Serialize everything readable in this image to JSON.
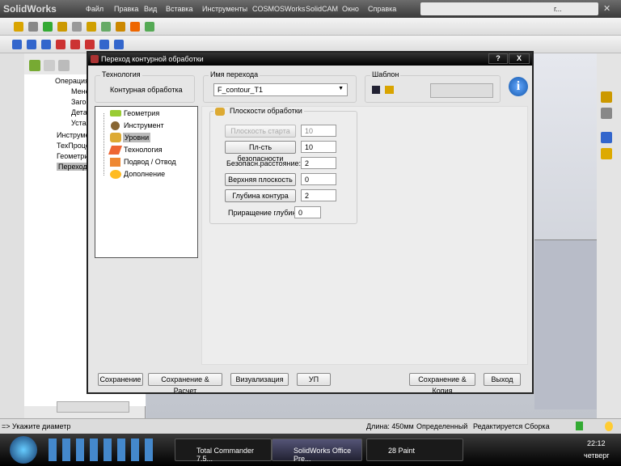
{
  "app": {
    "logo": "SolidWorks",
    "menu": [
      "Файл",
      "Правка",
      "Вид",
      "Вставка",
      "Инструменты",
      "COSMOSWorks",
      "SolidCAM",
      "Окно",
      "Справка"
    ],
    "search_short": "г..."
  },
  "tree": {
    "items": [
      "Операция",
      "Мене",
      "Заго",
      "Дета",
      "Уста",
      "Инструме",
      "ТехПроце",
      "Геометри",
      "Переход"
    ]
  },
  "dialog": {
    "title": "Переход контурной обработки",
    "help": "?",
    "close": "X",
    "tech_label": "Технология",
    "tech_value": "Контурная обработка",
    "name_label": "Имя перехода",
    "name_value": "F_contour_T1",
    "template_label": "Шаблон",
    "nav": [
      "Геометрия",
      "Инструмент",
      "Уровни",
      "Технология",
      "Подвод / Отвод",
      "Дополнение"
    ],
    "group_title": "Плоскости обработки",
    "fields": [
      {
        "label": "Плоскость старта",
        "value": "10",
        "type": "button-disabled"
      },
      {
        "label": "Пл-сть безопасности",
        "value": "10",
        "type": "button"
      },
      {
        "label": "Безопасн.расстояние:",
        "value": "2",
        "type": "label"
      },
      {
        "label": "Верхняя плоскость",
        "value": "0",
        "type": "button"
      },
      {
        "label": "Глубина контура",
        "value": "2",
        "type": "button"
      },
      {
        "label": "Приращение глубины:",
        "value": "0",
        "type": "label"
      }
    ],
    "buttons": [
      "Сохранение",
      "Сохранение & Расчет",
      "Визуализация",
      "УП",
      "Сохранение & Копия",
      "Выход"
    ]
  },
  "status": {
    "prompt": "=> Укажите диаметр",
    "length": "Длина: 450мм",
    "state": "Определенный",
    "mode": "Редактируется Сборка"
  },
  "taskbar": {
    "tasks": [
      "Total Commander 7.5...",
      "SolidWorks Office Pre...",
      "28 Paint"
    ],
    "time": "22:12",
    "day": "четверг"
  }
}
